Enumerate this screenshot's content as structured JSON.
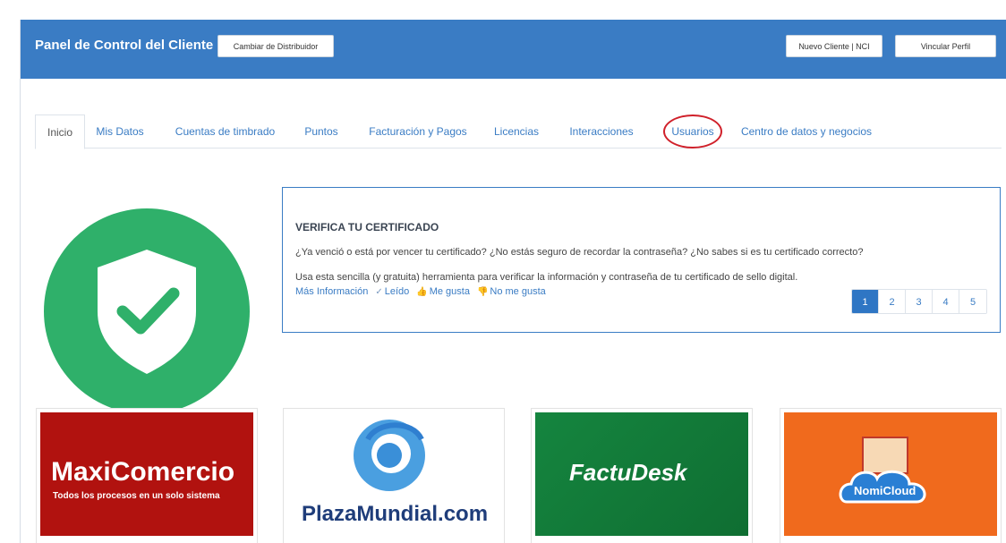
{
  "header": {
    "title": "Panel de Control del Cliente",
    "change_distributor_label": "Cambiar de Distribuidor",
    "new_client_label": "Nuevo Cliente | NCI",
    "link_profile_label": "Vincular Perfil",
    "bg_color": "#3a7cc4"
  },
  "tabs": [
    {
      "label": "Inicio",
      "active": true
    },
    {
      "label": "Mis Datos"
    },
    {
      "label": "Cuentas de timbrado"
    },
    {
      "label": "Puntos"
    },
    {
      "label": "Facturación y Pagos"
    },
    {
      "label": "Licencias"
    },
    {
      "label": "Interacciones"
    },
    {
      "label": "Usuarios",
      "highlighted": true
    },
    {
      "label": "Centro de datos y negocios"
    }
  ],
  "badge": {
    "icon": "shield-check-icon",
    "color": "#2fb06a"
  },
  "notice": {
    "title": "VERIFICA TU CERTIFICADO",
    "line1": "¿Ya venció o está por vencer tu certificado? ¿No estás seguro de recordar la contraseña? ¿No sabes si es tu certificado correcto?",
    "line2": "Usa esta sencilla (y gratuita) herramienta para verificar la información y contraseña de tu certificado de sello digital.",
    "more_info": "Más Información",
    "read": "Leído",
    "like": "Me gusta",
    "dislike": "No me gusta",
    "pages": [
      "1",
      "2",
      "3",
      "4",
      "5"
    ],
    "current_page": "1"
  },
  "products": [
    {
      "name": "MaxiComercio",
      "tagline": "Todos los procesos en un solo sistema"
    },
    {
      "name": "PlazaMundial.com"
    },
    {
      "name": "FactuDesk"
    },
    {
      "name": "NomiCloud"
    }
  ]
}
